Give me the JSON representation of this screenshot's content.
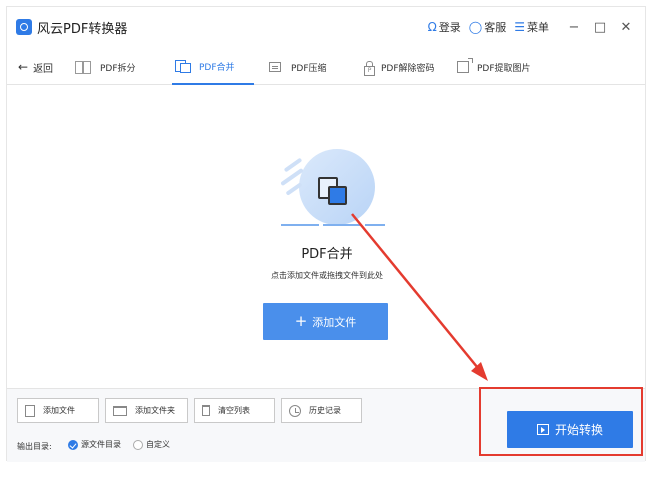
{
  "titlebar": {
    "title": "风云PDF转换器",
    "login_label": "登录",
    "service_label": "客服",
    "menu_label": "菜单",
    "minimize_glyph": "−",
    "maximize_glyph": "□",
    "close_glyph": "✕"
  },
  "toolbar": {
    "back_label": "返回",
    "tools": [
      {
        "label": "PDF拆分",
        "icon": "split-icon"
      },
      {
        "label": "PDF合并",
        "icon": "merge-icon",
        "active": true
      },
      {
        "label": "PDF压缩",
        "icon": "compress-icon"
      },
      {
        "label": "PDF解除密码",
        "icon": "unlock-icon"
      },
      {
        "label": "PDF提取图片",
        "icon": "image-extract-icon"
      }
    ]
  },
  "drop_area": {
    "title": "PDF合并",
    "hint": "点击添加文件或拖拽文件到此处",
    "add_button_label": "添加文件"
  },
  "bottom_bar": {
    "buttons": [
      "添加文件",
      "添加文件夹",
      "清空列表",
      "历史记录"
    ],
    "output_label": "输出目录:",
    "output_options": [
      {
        "label": "源文件目录",
        "checked": true
      },
      {
        "label": "自定义",
        "checked": false
      }
    ],
    "start_button_label": "开始转换"
  },
  "colors": {
    "accent": "#2f7be6",
    "annotation": "#e43b2f"
  }
}
